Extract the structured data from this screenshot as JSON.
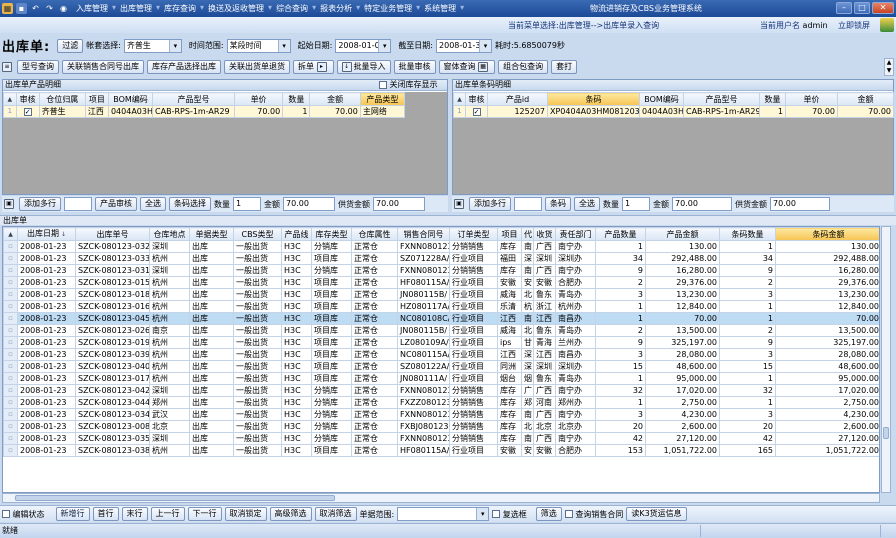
{
  "titlebar": {
    "app_title": "物流进销存及CBS业务管理系统",
    "menus": [
      "入库管理",
      "出库管理",
      "库存查询",
      "换送及返收管理",
      "综合查询",
      "报表分析",
      "特定业务管理",
      "系统管理"
    ],
    "quick_icons": [
      "app-icon",
      "save-icon",
      "undo-icon",
      "redo-icon",
      "dropdown-icon"
    ]
  },
  "navbar": {
    "path": "当前菜单选择:出库管理-->出库单录入查询",
    "user_label": "当前用户名",
    "user": "admin",
    "lock": "立即锁屏"
  },
  "filter": {
    "form_title": "出库单:",
    "filter_btn": "过滤",
    "account_label": "帐套选择:",
    "account_value": "齐普生",
    "time_label": "时间范围:",
    "time_value": "某段时间",
    "start_label": "起始日期:",
    "start_value": "2008-01-01",
    "end_label": "截至日期:",
    "end_value": "2008-01-31",
    "elapsed": "耗时:5.6850079秒"
  },
  "toolbar2": {
    "buttons": [
      "型号查询",
      "关联销售合同号出库",
      "库存产品选择出库",
      "关联出货单退货",
      "拆单",
      "批量导入",
      "批量审核",
      "窗体查询",
      "组合包查询",
      "套打"
    ]
  },
  "left_panel": {
    "title": "出库单产品明细",
    "close_stock": "关闭库存显示",
    "columns": [
      "审核",
      "仓位归属",
      "项目",
      "BOM编码",
      "产品型号",
      "单价",
      "数量",
      "金额",
      "产品类型"
    ],
    "rows": [
      {
        "rn": "1",
        "audit": "✓",
        "owner": "齐普生",
        "project": "江西",
        "bom": "0404A03H",
        "model": "CAB-RPS-1m-AR29",
        "price": "70.00",
        "qty": "1",
        "amount": "70.00",
        "ptype": "主网络"
      }
    ],
    "bottom": {
      "add": "添加多行",
      "audit": "产品审核",
      "all": "全选",
      "barcode_sel": "条码选择",
      "qty_label": "数量",
      "qty": "1",
      "amount_label": "金额",
      "amount": "70.00",
      "supply_label": "供货金额",
      "supply": "70.00"
    }
  },
  "right_panel": {
    "title": "出库单条码明细",
    "columns": [
      "审核",
      "产品id",
      "条码",
      "BOM编码",
      "产品型号",
      "数量",
      "单价",
      "金额"
    ],
    "rows": [
      {
        "rn": "1",
        "audit": "✓",
        "pid": "125207",
        "barcode": "XP0404A03HM081203819",
        "bom": "0404A03H",
        "model": "CAB-RPS-1m-AR29",
        "qty": "1",
        "price": "70.00",
        "amount": "70.00"
      }
    ],
    "bottom": {
      "add": "添加多行",
      "barcode": "条码",
      "all": "全选",
      "qty_label": "数量",
      "qty": "1",
      "amount_label": "金额",
      "amount": "70.00",
      "supply_label": "供货金额",
      "supply": "70.00"
    }
  },
  "main_grid": {
    "title": "出库单",
    "columns": [
      "出库日期",
      "出库单号",
      "仓库地点",
      "单据类型",
      "CBS类型",
      "产品线",
      "库存类型",
      "仓库属性",
      "销售合同号",
      "订单类型",
      "项目",
      "代",
      "收货",
      "责任部门",
      "产品数量",
      "产品金额",
      "条码数量",
      "条码金额"
    ],
    "rows": [
      [
        "2008-01-23",
        "SZCK-080123-032",
        "深圳",
        "出库",
        "一般出货",
        "H3C",
        "分销库",
        "正常仓",
        "FXNN080123",
        "分销销售",
        "库存",
        "南",
        "广西",
        "南宁办",
        "1",
        "130.00",
        "1",
        "130.00"
      ],
      [
        "2008-01-23",
        "SZCK-080123-033",
        "杭州",
        "出库",
        "一般出货",
        "H3C",
        "项目库",
        "正常仓",
        "SZ071228A/",
        "行业项目",
        "福田",
        "深",
        "深圳",
        "深圳办",
        "34",
        "292,488.00",
        "34",
        "292,488.00"
      ],
      [
        "2008-01-23",
        "SZCK-080123-031",
        "深圳",
        "出库",
        "一般出货",
        "H3C",
        "分销库",
        "正常仓",
        "FXNN080123",
        "分销销售",
        "库存",
        "南",
        "广西",
        "南宁办",
        "9",
        "16,280.00",
        "9",
        "16,280.00"
      ],
      [
        "2008-01-23",
        "SZCK-080123-015",
        "杭州",
        "出库",
        "一般出货",
        "H3C",
        "项目库",
        "正常仓",
        "HF080115A/",
        "行业项目",
        "安徽",
        "安",
        "安徽",
        "合肥办",
        "2",
        "29,376.00",
        "2",
        "29,376.00"
      ],
      [
        "2008-01-23",
        "SZCK-080123-018",
        "杭州",
        "出库",
        "一般出货",
        "H3C",
        "项目库",
        "正常仓",
        "JN080115B/",
        "行业项目",
        "威海",
        "北",
        "鲁东",
        "青岛办",
        "3",
        "13,230.00",
        "3",
        "13,230.00"
      ],
      [
        "2008-01-23",
        "SZCK-080123-016",
        "杭州",
        "出库",
        "一般出货",
        "H3C",
        "项目库",
        "正常仓",
        "HZ080117A/",
        "行业项目",
        "乐清",
        "杭",
        "浙江",
        "杭州办",
        "1",
        "12,840.00",
        "1",
        "12,840.00"
      ],
      [
        "2008-01-23",
        "SZCK-080123-045",
        "杭州",
        "出库",
        "一般出货",
        "H3C",
        "项目库",
        "正常仓",
        "NC080108C/",
        "行业项目",
        "江西",
        "南",
        "江西",
        "南昌办",
        "1",
        "70.00",
        "1",
        "70.00"
      ],
      [
        "2008-01-23",
        "SZCK-080123-026",
        "南京",
        "出库",
        "一般出货",
        "H3C",
        "项目库",
        "正常仓",
        "JN080115B/",
        "行业项目",
        "威海",
        "北",
        "鲁东",
        "青岛办",
        "2",
        "13,500.00",
        "2",
        "13,500.00"
      ],
      [
        "2008-01-23",
        "SZCK-080123-019",
        "杭州",
        "出库",
        "一般出货",
        "H3C",
        "项目库",
        "正常仓",
        "LZ080109A/",
        "行业项目",
        "ips",
        "甘",
        "青海",
        "兰州办",
        "9",
        "325,197.00",
        "9",
        "325,197.00"
      ],
      [
        "2008-01-23",
        "SZCK-080123-039",
        "杭州",
        "出库",
        "一般出货",
        "H3C",
        "项目库",
        "正常仓",
        "NC080115A/",
        "行业项目",
        "江西",
        "深",
        "江西",
        "南昌办",
        "3",
        "28,080.00",
        "3",
        "28,080.00"
      ],
      [
        "2008-01-23",
        "SZCK-080123-040",
        "杭州",
        "出库",
        "一般出货",
        "H3C",
        "项目库",
        "正常仓",
        "SZ080122A/",
        "行业项目",
        "同洲",
        "深",
        "深圳",
        "深圳办",
        "15",
        "48,600.00",
        "15",
        "48,600.00"
      ],
      [
        "2008-01-23",
        "SZCK-080123-017",
        "杭州",
        "出库",
        "一般出货",
        "H3C",
        "项目库",
        "正常仓",
        "JN080111A/",
        "行业项目",
        "烟台",
        "烟",
        "鲁东",
        "青岛办",
        "1",
        "95,000.00",
        "1",
        "95,000.00"
      ],
      [
        "2008-01-23",
        "SZCK-080123-042",
        "深圳",
        "出库",
        "一般出货",
        "H3C",
        "分销库",
        "正常仓",
        "FXNN080123",
        "分销销售",
        "库存",
        "广",
        "广西",
        "南宁办",
        "32",
        "17,020.00",
        "32",
        "17,020.00"
      ],
      [
        "2008-01-23",
        "SZCK-080123-044",
        "郑州",
        "出库",
        "一般出货",
        "H3C",
        "分销库",
        "正常仓",
        "FXZZ080123",
        "分销销售",
        "库存",
        "郑",
        "河南",
        "郑州办",
        "1",
        "2,750.00",
        "1",
        "2,750.00"
      ],
      [
        "2008-01-23",
        "SZCK-080123-034",
        "武汉",
        "出库",
        "一般出货",
        "H3C",
        "分销库",
        "正常仓",
        "FXNN080123",
        "分销销售",
        "库存",
        "南",
        "广西",
        "南宁办",
        "3",
        "4,230.00",
        "3",
        "4,230.00"
      ],
      [
        "2008-01-23",
        "SZCK-080123-008",
        "北京",
        "出库",
        "一般出货",
        "H3C",
        "分销库",
        "正常仓",
        "FXBJ080123",
        "分销销售",
        "库存",
        "北",
        "北京",
        "北京办",
        "20",
        "2,600.00",
        "20",
        "2,600.00"
      ],
      [
        "2008-01-23",
        "SZCK-080123-035",
        "深圳",
        "出库",
        "一般出货",
        "H3C",
        "分销库",
        "正常仓",
        "FXNN080123",
        "分销销售",
        "库存",
        "南",
        "广西",
        "南宁办",
        "42",
        "27,120.00",
        "42",
        "27,120.00"
      ],
      [
        "2008-01-23",
        "SZCK-080123-038",
        "杭州",
        "出库",
        "一般出货",
        "H3C",
        "项目库",
        "正常仓",
        "HF080115A/",
        "行业项目",
        "安徽",
        "安",
        "安徽",
        "合肥办",
        "153",
        "1,051,722.00",
        "165",
        "1,051,722.00"
      ]
    ]
  },
  "bottombar": {
    "edit_state": "编辑状态",
    "buttons": [
      "新增行",
      "首行",
      "末行",
      "上一行",
      "下一行",
      "取消锁定",
      "高级筛选",
      "取消筛选"
    ],
    "range_label": "单据范围:",
    "checkbox_label": "复选框",
    "filter_btn": "筛选",
    "query_contract": "查询销售合同",
    "read_k3": "读K3货运信息"
  },
  "status": {
    "text": "就绪"
  }
}
